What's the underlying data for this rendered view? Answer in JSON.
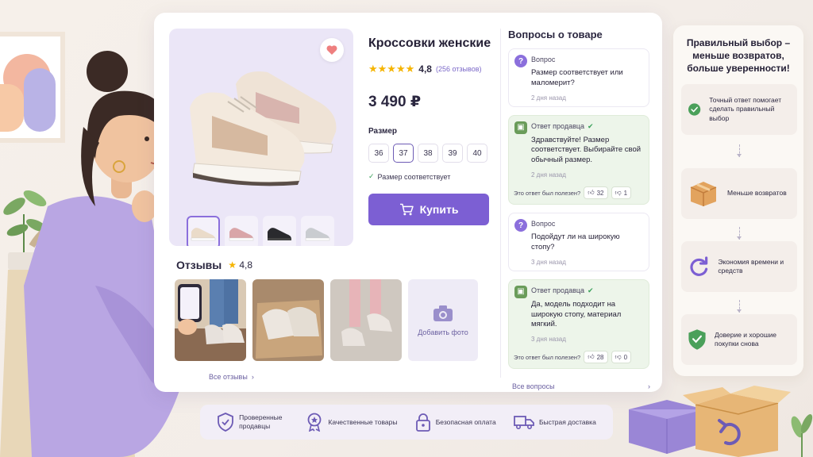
{
  "product": {
    "title": "Кроссовки женские",
    "rating": "4,8",
    "reviews_count": "(256 отзывов)",
    "price": "3 490 ₽",
    "size_label": "Размер",
    "sizes": [
      "36",
      "37",
      "38",
      "39",
      "40"
    ],
    "selected_size": "37",
    "fit_note": "Размер соответствует",
    "buy_label": "Купить"
  },
  "reviews": {
    "title": "Отзывы",
    "rating": "4,8",
    "add_photo": "Добавить фото",
    "all_link": "Все отзывы"
  },
  "qa": {
    "title": "Вопросы о товаре",
    "items": [
      {
        "label": "Вопрос",
        "text": "Размер соответствует или маломерит?",
        "date": "2 дня назад"
      },
      {
        "label": "Ответ продавца",
        "text": "Здравствуйте! Размер соответствует. Выбирайте свой обычный размер.",
        "date": "2 дня назад",
        "helpful": "Это ответ был полезен?",
        "up": "32",
        "down": "1"
      },
      {
        "label": "Вопрос",
        "text": "Подойдут ли на широкую стопу?",
        "date": "3 дня назад"
      },
      {
        "label": "Ответ продавца",
        "text": "Да, модель подходит на широкую стопу, материал мягкий.",
        "date": "3 дня назад",
        "helpful": "Это ответ был полезен?",
        "up": "28",
        "down": "0"
      }
    ],
    "all_link": "Все вопросы"
  },
  "trust": [
    {
      "icon": "shield-check-icon",
      "label": "Проверенные продавцы"
    },
    {
      "icon": "quality-badge-icon",
      "label": "Качественные товары"
    },
    {
      "icon": "lock-icon",
      "label": "Безопасная оплата"
    },
    {
      "icon": "truck-icon",
      "label": "Быстрая доставка"
    }
  ],
  "benefits": {
    "title": "Правильный выбор – меньше возвратов, больше уверенности!",
    "items": [
      {
        "icon": "check-circle-icon",
        "text": "Точный ответ помогает сделать правильный выбор"
      },
      {
        "icon": "box-icon",
        "text": "Меньше возвратов"
      },
      {
        "icon": "refresh-icon",
        "text": "Экономия времени и средств"
      },
      {
        "icon": "shield-check-icon",
        "text": "Доверие и хорошие покупки снова"
      }
    ]
  },
  "colors": {
    "accent": "#7c5fd3",
    "star": "#f5b400",
    "success": "#3aa05a",
    "answer_bg": "#edf5ea"
  }
}
